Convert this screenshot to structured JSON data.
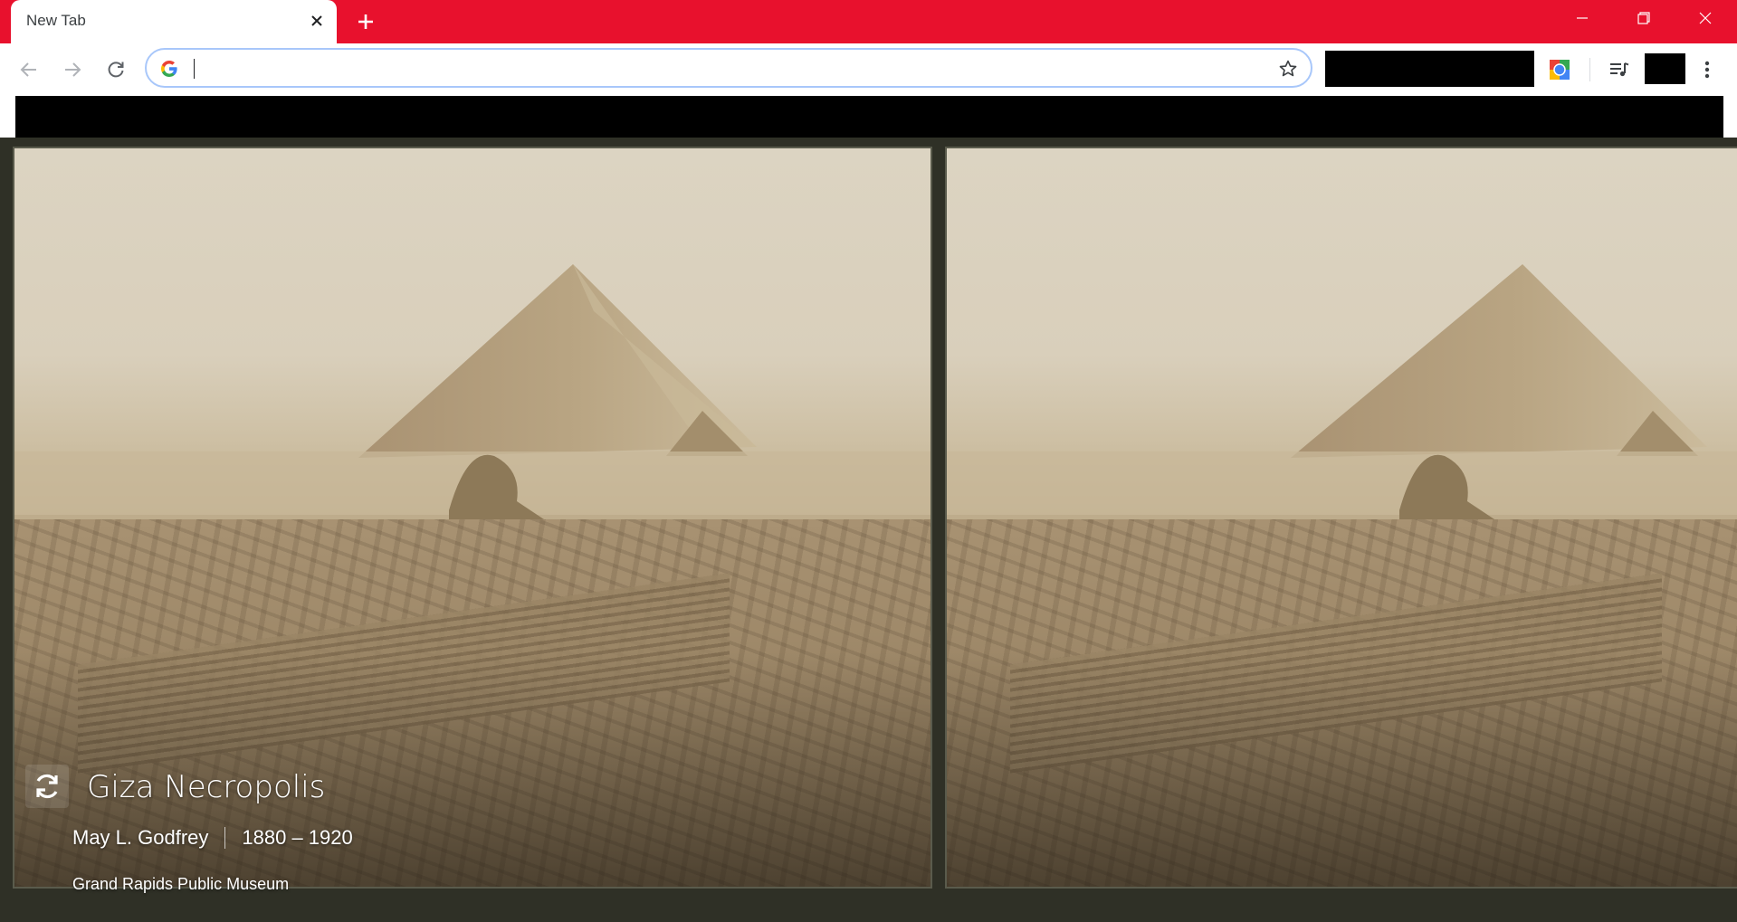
{
  "browser": {
    "accent_color": "#e8112d",
    "tab": {
      "title": "New Tab",
      "close_icon": "close-icon"
    },
    "new_tab_icon": "plus-icon",
    "window_controls": [
      "minimize-icon",
      "restore-icon",
      "close-window-icon"
    ]
  },
  "toolbar": {
    "back_icon": "arrow-left-icon",
    "forward_icon": "arrow-right-icon",
    "reload_icon": "reload-icon",
    "omnibox": {
      "value": "",
      "placeholder": "",
      "provider_icon": "google-g-icon"
    },
    "bookmark_icon": "star-outline-icon",
    "extension_icon": "colorful-extension-icon",
    "media_icon": "media-queue-icon",
    "menu_icon": "kebab-menu-icon"
  },
  "background": {
    "title": "Giza Necropolis",
    "creator": "May L. Godfrey",
    "date": "1880 – 1920",
    "collection": "Grand Rapids Public Museum",
    "refresh_icon": "refresh-icon"
  }
}
